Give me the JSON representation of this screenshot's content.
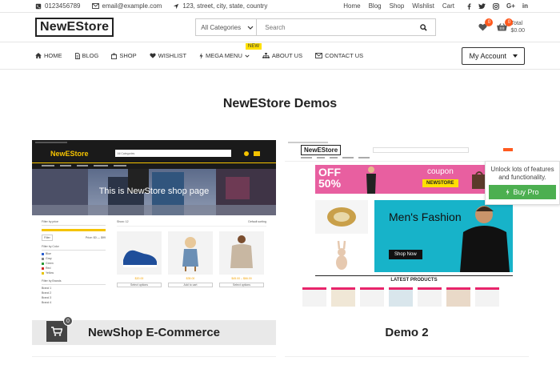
{
  "topbar": {
    "phone": "0123456789",
    "email": "email@example.com",
    "address": "123, street, city, state, country",
    "links": [
      "Home",
      "Blog",
      "Shop",
      "Wishlist",
      "Cart"
    ],
    "social": [
      "facebook-icon",
      "twitter-icon",
      "instagram-icon",
      "googleplus-icon",
      "linkedin-icon"
    ],
    "social_text": {
      "gplus": "G+",
      "linkedin": "in"
    }
  },
  "header": {
    "logo": "NewEStore",
    "category_select": "All Categories",
    "search_placeholder": "Search",
    "wishlist_count": "0",
    "cart_count": "0",
    "total_label": "Total",
    "total_value": "$0.00"
  },
  "nav": {
    "items": [
      "Home",
      "Blog",
      "Shop",
      "Wishlist",
      "Mega Menu",
      "About Us",
      "Contact Us"
    ],
    "new_badge": "NEW",
    "account_label": "My Account"
  },
  "main": {
    "title": "NewEStore Demos",
    "demos": [
      {
        "caption": "NewShop E-Commerce",
        "hero_text": "This is NewStore shop page",
        "logo": "NewEStore",
        "cart_count": "0",
        "mini_category": "All Categories",
        "mini_sort": "Show: 12",
        "mini_sort_by": "Default sorting",
        "filters": [
          "Filter by price",
          "Filter by Color",
          "Filter by Brands"
        ],
        "price_range": "Price: $0 — $99",
        "filter_button": "Filter",
        "colors": [
          "Blue",
          "Gray",
          "Green",
          "Red",
          "Yellow"
        ],
        "brands": [
          "Brand 1",
          "Brand 2",
          "Brand 3",
          "Brand 4"
        ],
        "product_buttons": [
          "Select options",
          "Add to cart",
          "Select options"
        ],
        "prices": [
          "$20.00",
          "$35.00",
          "$45.00 – $66.00"
        ]
      },
      {
        "caption": "Demo 2",
        "logo": "NewEStore",
        "banner_off": "OFF 50%",
        "banner_coupon": "coupon",
        "banner_code": "NEWSTORE",
        "hero_title": "Men's Fashion",
        "hero_button": "Shop Now",
        "latest": "LATEST PRODUCTS"
      }
    ]
  },
  "upsell": {
    "text": "Unlock lots of features and functionality.",
    "button": "Buy Pro"
  },
  "colors": {
    "accent_orange": "#ff5a1f",
    "buy_green": "#4caf50",
    "demo1_header_bg": "#1a1a1a",
    "demo1_logo_yellow": "#f5c300",
    "demo2_banner_pink": "#e85fa0"
  }
}
